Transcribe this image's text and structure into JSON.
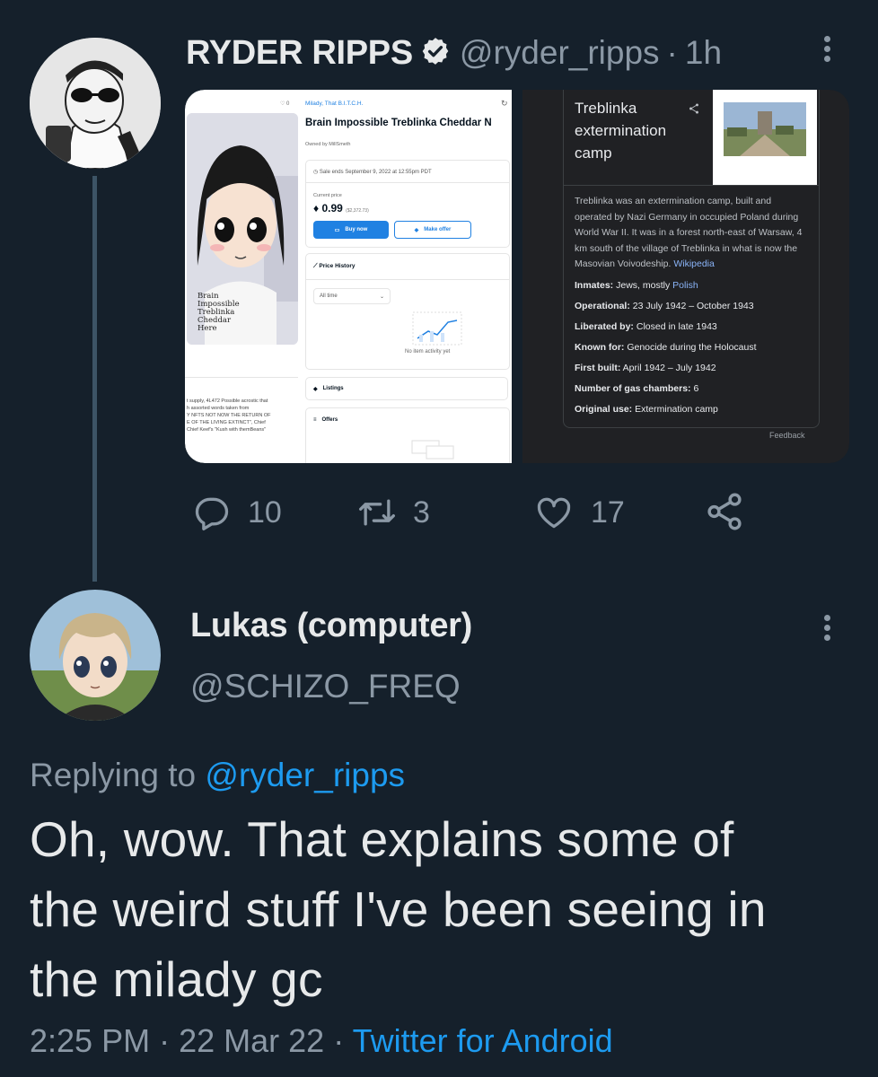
{
  "tweet": {
    "display_name": "RYDER RIPPS",
    "handle": "@ryder_ripps",
    "separator": "·",
    "time": "1h",
    "actions": {
      "replies": "10",
      "retweets": "3",
      "likes": "17"
    },
    "media": {
      "listing": {
        "collection": "Milady, That B.I.T.C.H.",
        "likes": "0",
        "title": "Brain Impossible Treblinka Cheddar N",
        "owner": "Owned by MillSmeth",
        "sale_ends": "Sale ends September 9, 2022 at 12:55pm PDT",
        "current_price_label": "Current price",
        "price": "0.99",
        "price_usd": "($2,372.73)",
        "buy_label": "Buy now",
        "offer_label": "Make offer",
        "price_history_label": "Price History",
        "time_filter": "All time",
        "no_activity": "No item activity yet",
        "listings_label": "Listings",
        "offers_label": "Offers",
        "shirt_text": "Brain\nImpossible\nTreblinka\nCheddar\nHere",
        "description": "t supply, 4L472 Possible acrostic that\nh assorted words taken from\nY NFTS NOT NOW THE RETURN OF\nE OF THE LIVING EXTINCT\", Chief\nChief Keef's \"Kush with themBeans\""
      },
      "knowledge_panel": {
        "title": "Treblinka extermination camp",
        "summary": "Treblinka was an extermination camp, built and operated by Nazi Germany in occupied Poland during World War II. It was in a forest north-east of Warsaw, 4 km south of the village of Treblinka in what is now the Masovian Voivodeship.",
        "summary_link": "Wikipedia",
        "facts": [
          {
            "label": "Inmates:",
            "value": "Jews, mostly ",
            "link": "Polish"
          },
          {
            "label": "Operational:",
            "value": "23 July 1942 – October 1943",
            "link": ""
          },
          {
            "label": "Liberated by:",
            "value": "Closed in late 1943",
            "link": ""
          },
          {
            "label": "Known for:",
            "value": "Genocide during the Holocaust",
            "link": ""
          },
          {
            "label": "First built:",
            "value": "April 1942 – July 1942",
            "link": ""
          },
          {
            "label": "Number of gas chambers:",
            "value": "6",
            "link": ""
          },
          {
            "label": "Original use:",
            "value": "Extermination camp",
            "link": ""
          }
        ],
        "feedback": "Feedback"
      }
    }
  },
  "reply": {
    "display_name": "Lukas (computer)",
    "handle": "@SCHIZO_FREQ",
    "replying_prefix": "Replying to",
    "replying_handle": "@ryder_ripps",
    "text_line1": "Oh, wow. That explains some of",
    "text_line2": "the weird stuff I've been seeing in",
    "text_line3": "the milady gc",
    "time": "2:25 PM",
    "date": "22 Mar 22",
    "client": "Twitter for Android",
    "separator": "·"
  },
  "colors": {
    "background": "#15202b",
    "text": "#e7e9ea",
    "secondary": "#8b98a5",
    "link": "#1d9bf0"
  }
}
